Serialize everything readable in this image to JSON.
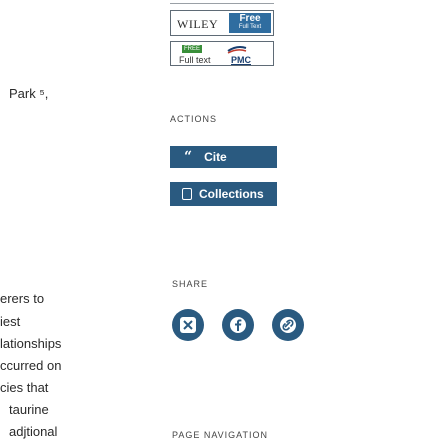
{
  "article": {
    "fragments": [
      "Park ⁵,",
      "erers to",
      "iest",
      "lationships",
      "ccurred on",
      "cies that",
      "taurine",
      "adjtional"
    ]
  },
  "wiley": {
    "logo": "WILEY",
    "badge_main": "Free",
    "badge_sub": "Full Text"
  },
  "pmc": {
    "free_tag": "FREE",
    "fulltext": "Full text",
    "pmc": "PMC"
  },
  "actions": {
    "label": "ACTIONS",
    "cite": "Cite",
    "collections": "Collections"
  },
  "share": {
    "label": "SHARE",
    "icons": [
      "x-icon",
      "facebook-icon",
      "link-icon"
    ]
  },
  "page_navigation": {
    "label": "PAGE NAVIGATION"
  },
  "colors": {
    "button": "#2a5a80",
    "wiley_badge": "#2f6da0",
    "free_tag": "#3a8f3a"
  }
}
